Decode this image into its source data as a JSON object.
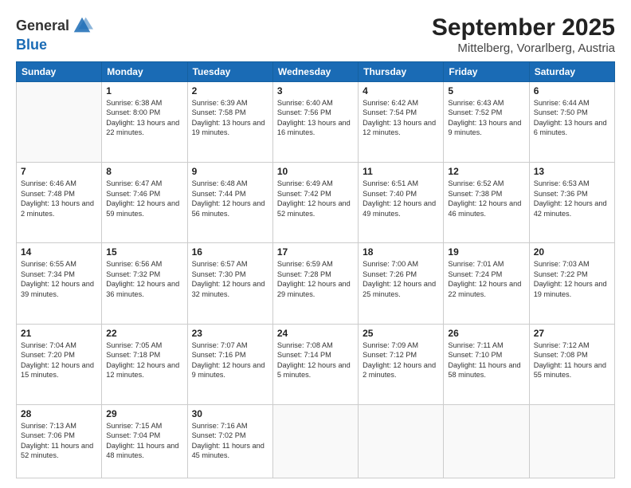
{
  "header": {
    "logo_line1": "General",
    "logo_line2": "Blue",
    "title": "September 2025",
    "subtitle": "Mittelberg, Vorarlberg, Austria"
  },
  "weekdays": [
    "Sunday",
    "Monday",
    "Tuesday",
    "Wednesday",
    "Thursday",
    "Friday",
    "Saturday"
  ],
  "weeks": [
    [
      {
        "day": "",
        "sunrise": "",
        "sunset": "",
        "daylight": ""
      },
      {
        "day": "1",
        "sunrise": "Sunrise: 6:38 AM",
        "sunset": "Sunset: 8:00 PM",
        "daylight": "Daylight: 13 hours and 22 minutes."
      },
      {
        "day": "2",
        "sunrise": "Sunrise: 6:39 AM",
        "sunset": "Sunset: 7:58 PM",
        "daylight": "Daylight: 13 hours and 19 minutes."
      },
      {
        "day": "3",
        "sunrise": "Sunrise: 6:40 AM",
        "sunset": "Sunset: 7:56 PM",
        "daylight": "Daylight: 13 hours and 16 minutes."
      },
      {
        "day": "4",
        "sunrise": "Sunrise: 6:42 AM",
        "sunset": "Sunset: 7:54 PM",
        "daylight": "Daylight: 13 hours and 12 minutes."
      },
      {
        "day": "5",
        "sunrise": "Sunrise: 6:43 AM",
        "sunset": "Sunset: 7:52 PM",
        "daylight": "Daylight: 13 hours and 9 minutes."
      },
      {
        "day": "6",
        "sunrise": "Sunrise: 6:44 AM",
        "sunset": "Sunset: 7:50 PM",
        "daylight": "Daylight: 13 hours and 6 minutes."
      }
    ],
    [
      {
        "day": "7",
        "sunrise": "Sunrise: 6:46 AM",
        "sunset": "Sunset: 7:48 PM",
        "daylight": "Daylight: 13 hours and 2 minutes."
      },
      {
        "day": "8",
        "sunrise": "Sunrise: 6:47 AM",
        "sunset": "Sunset: 7:46 PM",
        "daylight": "Daylight: 12 hours and 59 minutes."
      },
      {
        "day": "9",
        "sunrise": "Sunrise: 6:48 AM",
        "sunset": "Sunset: 7:44 PM",
        "daylight": "Daylight: 12 hours and 56 minutes."
      },
      {
        "day": "10",
        "sunrise": "Sunrise: 6:49 AM",
        "sunset": "Sunset: 7:42 PM",
        "daylight": "Daylight: 12 hours and 52 minutes."
      },
      {
        "day": "11",
        "sunrise": "Sunrise: 6:51 AM",
        "sunset": "Sunset: 7:40 PM",
        "daylight": "Daylight: 12 hours and 49 minutes."
      },
      {
        "day": "12",
        "sunrise": "Sunrise: 6:52 AM",
        "sunset": "Sunset: 7:38 PM",
        "daylight": "Daylight: 12 hours and 46 minutes."
      },
      {
        "day": "13",
        "sunrise": "Sunrise: 6:53 AM",
        "sunset": "Sunset: 7:36 PM",
        "daylight": "Daylight: 12 hours and 42 minutes."
      }
    ],
    [
      {
        "day": "14",
        "sunrise": "Sunrise: 6:55 AM",
        "sunset": "Sunset: 7:34 PM",
        "daylight": "Daylight: 12 hours and 39 minutes."
      },
      {
        "day": "15",
        "sunrise": "Sunrise: 6:56 AM",
        "sunset": "Sunset: 7:32 PM",
        "daylight": "Daylight: 12 hours and 36 minutes."
      },
      {
        "day": "16",
        "sunrise": "Sunrise: 6:57 AM",
        "sunset": "Sunset: 7:30 PM",
        "daylight": "Daylight: 12 hours and 32 minutes."
      },
      {
        "day": "17",
        "sunrise": "Sunrise: 6:59 AM",
        "sunset": "Sunset: 7:28 PM",
        "daylight": "Daylight: 12 hours and 29 minutes."
      },
      {
        "day": "18",
        "sunrise": "Sunrise: 7:00 AM",
        "sunset": "Sunset: 7:26 PM",
        "daylight": "Daylight: 12 hours and 25 minutes."
      },
      {
        "day": "19",
        "sunrise": "Sunrise: 7:01 AM",
        "sunset": "Sunset: 7:24 PM",
        "daylight": "Daylight: 12 hours and 22 minutes."
      },
      {
        "day": "20",
        "sunrise": "Sunrise: 7:03 AM",
        "sunset": "Sunset: 7:22 PM",
        "daylight": "Daylight: 12 hours and 19 minutes."
      }
    ],
    [
      {
        "day": "21",
        "sunrise": "Sunrise: 7:04 AM",
        "sunset": "Sunset: 7:20 PM",
        "daylight": "Daylight: 12 hours and 15 minutes."
      },
      {
        "day": "22",
        "sunrise": "Sunrise: 7:05 AM",
        "sunset": "Sunset: 7:18 PM",
        "daylight": "Daylight: 12 hours and 12 minutes."
      },
      {
        "day": "23",
        "sunrise": "Sunrise: 7:07 AM",
        "sunset": "Sunset: 7:16 PM",
        "daylight": "Daylight: 12 hours and 9 minutes."
      },
      {
        "day": "24",
        "sunrise": "Sunrise: 7:08 AM",
        "sunset": "Sunset: 7:14 PM",
        "daylight": "Daylight: 12 hours and 5 minutes."
      },
      {
        "day": "25",
        "sunrise": "Sunrise: 7:09 AM",
        "sunset": "Sunset: 7:12 PM",
        "daylight": "Daylight: 12 hours and 2 minutes."
      },
      {
        "day": "26",
        "sunrise": "Sunrise: 7:11 AM",
        "sunset": "Sunset: 7:10 PM",
        "daylight": "Daylight: 11 hours and 58 minutes."
      },
      {
        "day": "27",
        "sunrise": "Sunrise: 7:12 AM",
        "sunset": "Sunset: 7:08 PM",
        "daylight": "Daylight: 11 hours and 55 minutes."
      }
    ],
    [
      {
        "day": "28",
        "sunrise": "Sunrise: 7:13 AM",
        "sunset": "Sunset: 7:06 PM",
        "daylight": "Daylight: 11 hours and 52 minutes."
      },
      {
        "day": "29",
        "sunrise": "Sunrise: 7:15 AM",
        "sunset": "Sunset: 7:04 PM",
        "daylight": "Daylight: 11 hours and 48 minutes."
      },
      {
        "day": "30",
        "sunrise": "Sunrise: 7:16 AM",
        "sunset": "Sunset: 7:02 PM",
        "daylight": "Daylight: 11 hours and 45 minutes."
      },
      {
        "day": "",
        "sunrise": "",
        "sunset": "",
        "daylight": ""
      },
      {
        "day": "",
        "sunrise": "",
        "sunset": "",
        "daylight": ""
      },
      {
        "day": "",
        "sunrise": "",
        "sunset": "",
        "daylight": ""
      },
      {
        "day": "",
        "sunrise": "",
        "sunset": "",
        "daylight": ""
      }
    ]
  ]
}
